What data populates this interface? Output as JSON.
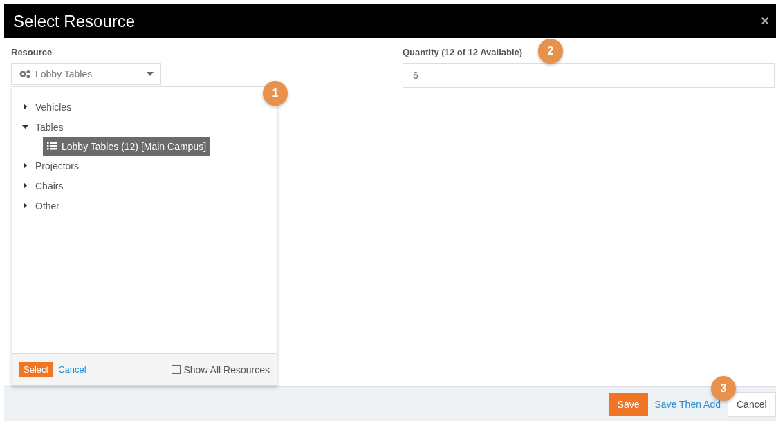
{
  "window": {
    "title": "Select Resource",
    "close": "×"
  },
  "resource": {
    "label": "Resource",
    "value": "Lobby Tables"
  },
  "picker": {
    "tree": [
      {
        "label": "Vehicles",
        "expanded": false
      },
      {
        "label": "Tables",
        "expanded": true,
        "children": [
          {
            "label": "Lobby Tables (12) [Main Campus]",
            "selected": true
          }
        ]
      },
      {
        "label": "Projectors",
        "expanded": false
      },
      {
        "label": "Chairs",
        "expanded": false
      },
      {
        "label": "Other",
        "expanded": false
      }
    ],
    "select": "Select",
    "cancel": "Cancel",
    "show_all": {
      "label": "Show All Resources",
      "checked": false
    }
  },
  "quantity": {
    "label": "Quantity (12 of 12 Available)",
    "value": "6"
  },
  "badges": [
    "1",
    "2",
    "3"
  ],
  "footer": {
    "save": "Save",
    "save_then_add": "Save Then Add",
    "cancel": "Cancel"
  }
}
